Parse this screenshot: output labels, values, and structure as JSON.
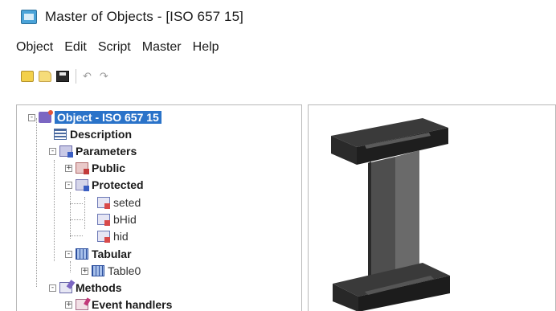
{
  "window": {
    "title": "Master of Objects - [ISO 657 15]"
  },
  "menu": {
    "items": [
      "Object",
      "Edit",
      "Script",
      "Master",
      "Help"
    ]
  },
  "toolbar": {
    "undo_glyph": "↶",
    "redo_glyph": "↷"
  },
  "tree": {
    "expander_minus": "-",
    "expander_plus": "+",
    "nodes": [
      {
        "label": "Object - ISO 657 15",
        "icon": "object-icon",
        "selected": true
      },
      {
        "label": "Description",
        "icon": "description-icon"
      },
      {
        "label": "Parameters",
        "icon": "parameters-icon"
      },
      {
        "label": "Public",
        "icon": "public-params-icon"
      },
      {
        "label": "Protected",
        "icon": "protected-params-icon"
      },
      {
        "label": "seted",
        "icon": "variable-icon"
      },
      {
        "label": "bHid",
        "icon": "variable-icon"
      },
      {
        "label": "hid",
        "icon": "variable-icon"
      },
      {
        "label": "Tabular",
        "icon": "table-icon"
      },
      {
        "label": "Table0",
        "icon": "table-icon"
      },
      {
        "label": "Methods",
        "icon": "methods-icon"
      },
      {
        "label": "Event handlers",
        "icon": "event-handlers-icon"
      }
    ]
  },
  "preview": {
    "model": "I-beam steel profile",
    "colors": {
      "dark": "#2a2a2a",
      "mid": "#4a4a4a",
      "light": "#6a6a6a"
    }
  },
  "colors": {
    "selection": "#2a73c9",
    "border": "#b8b8b8"
  }
}
